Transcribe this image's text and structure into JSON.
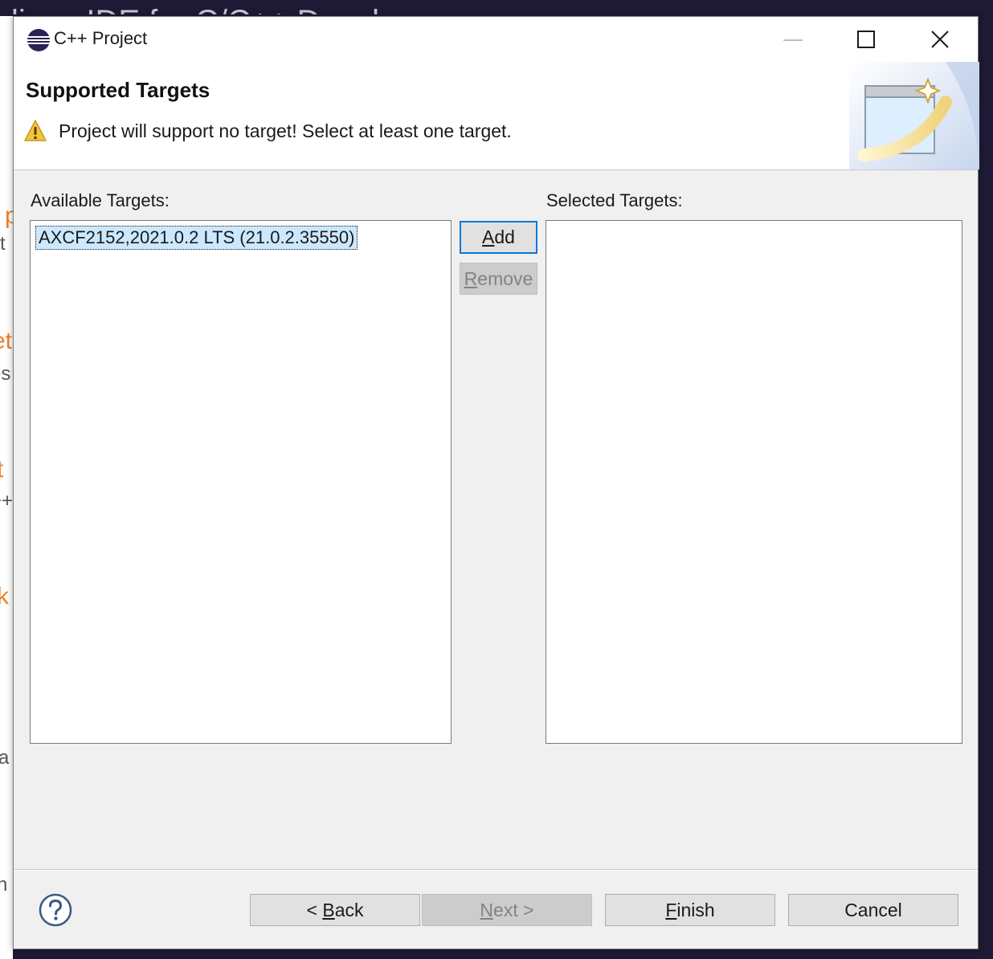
{
  "background": {
    "ide_title": "clipse IDE for C/C++ Developers",
    "fragments": [
      "p",
      "rt",
      "et",
      "es",
      "t",
      "++",
      "k",
      "a",
      "n"
    ]
  },
  "dialog": {
    "title": "C++ Project",
    "window_controls": {
      "minimize": "—",
      "maximize": "☐",
      "close": "✕"
    },
    "header": {
      "title": "Supported Targets",
      "message": "Project will support no target! Select at least one target.",
      "message_icon": "warning-icon"
    },
    "available": {
      "label": "Available Targets:",
      "items": [
        "AXCF2152,2021.0.2 LTS (21.0.2.35550)"
      ],
      "selected_index": 0
    },
    "selected": {
      "label": "Selected Targets:",
      "items": []
    },
    "buttons": {
      "add": {
        "mnemonic": "A",
        "rest": "dd",
        "enabled": true
      },
      "remove": {
        "mnemonic": "R",
        "rest": "emove",
        "enabled": false
      },
      "back": {
        "prefix": "< ",
        "mnemonic": "B",
        "rest": "ack",
        "enabled": true
      },
      "next": {
        "mnemonic": "N",
        "rest": "ext >",
        "enabled": false
      },
      "finish": {
        "mnemonic": "F",
        "rest": "inish",
        "enabled": true
      },
      "cancel": {
        "label": "Cancel",
        "enabled": true
      }
    },
    "help_icon": "question-circle-icon"
  },
  "colors": {
    "accent": "#0078d7",
    "selection": "#cce8ff",
    "warning": "#f5c342",
    "bg_orange": "#e8842a"
  }
}
